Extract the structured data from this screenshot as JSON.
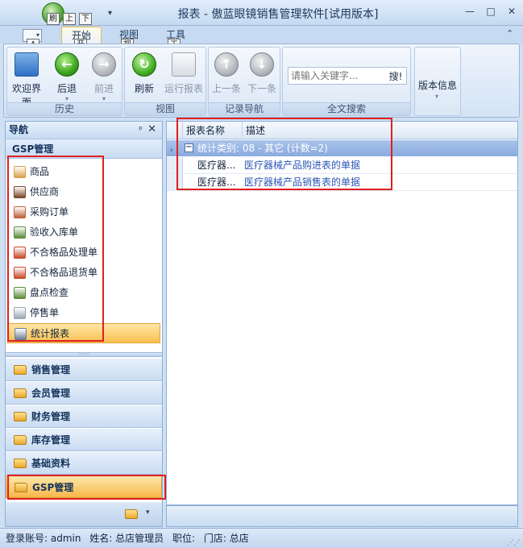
{
  "window": {
    "title": "报表 - 傲蓝眼镜销售管理软件[试用版本]",
    "buttons": {
      "minimize": "—",
      "maximize": "□",
      "close": "✕"
    }
  },
  "quick_access": {
    "tip_refresh": "刷",
    "tip_up": "上",
    "tip_down": "下",
    "tip_app": "A"
  },
  "tabs": [
    {
      "label": "开始",
      "tip": "开"
    },
    {
      "label": "视图",
      "tip": "视"
    },
    {
      "label": "工具",
      "tip": "工"
    }
  ],
  "ribbon": {
    "history": {
      "label": "历史",
      "buttons": [
        {
          "label": "欢迎界面"
        },
        {
          "label": "后退"
        },
        {
          "label": "前进"
        }
      ]
    },
    "view": {
      "label": "视图",
      "buttons": [
        {
          "label": "刷新"
        },
        {
          "label": "运行报表"
        }
      ]
    },
    "record_nav": {
      "label": "记录导航",
      "buttons": [
        {
          "label": "上一条"
        },
        {
          "label": "下一条"
        }
      ]
    },
    "fulltext": {
      "label": "全文搜索",
      "placeholder": "请输入关键字...",
      "search_button": "搜!"
    },
    "version": {
      "label": "版本信息"
    }
  },
  "nav": {
    "title": "导航",
    "pin": "ᵖ",
    "close": "✕",
    "section": "GSP管理",
    "items": [
      {
        "label": "商品",
        "color": "#d9a04b"
      },
      {
        "label": "供应商",
        "color": "#7a4a2a"
      },
      {
        "label": "采购订单",
        "color": "#c0603a"
      },
      {
        "label": "验收入库单",
        "color": "#5a8c3a"
      },
      {
        "label": "不合格品处理单",
        "color": "#c84a2a"
      },
      {
        "label": "不合格品退货单",
        "color": "#c84a2a"
      },
      {
        "label": "盘点检查",
        "color": "#5a8c3a"
      },
      {
        "label": "停售单",
        "color": "#9aa6b4"
      },
      {
        "label": "统计报表",
        "color": "#6b7f99",
        "selected": true
      }
    ],
    "groups": [
      {
        "label": "销售管理"
      },
      {
        "label": "会员管理"
      },
      {
        "label": "财务管理"
      },
      {
        "label": "库存管理"
      },
      {
        "label": "基础资料"
      },
      {
        "label": "GSP管理",
        "active": true
      }
    ]
  },
  "grid": {
    "columns": [
      "报表名称",
      "描述"
    ],
    "group_row": "统计类别: 08 - 其它 (计数=2)",
    "rows": [
      {
        "name": "医疗器...",
        "desc": "医疗器械产品购进表的单据"
      },
      {
        "name": "医疗器...",
        "desc": "医疗器械产品销售表的单据"
      }
    ]
  },
  "status": {
    "account": "登录账号: admin",
    "name": "姓名: 总店管理员",
    "role": "职位:",
    "store": "门店: 总店"
  },
  "colors": {
    "accent": "#f8bf50",
    "highlight": "#e02020",
    "link": "#2b55b3"
  }
}
